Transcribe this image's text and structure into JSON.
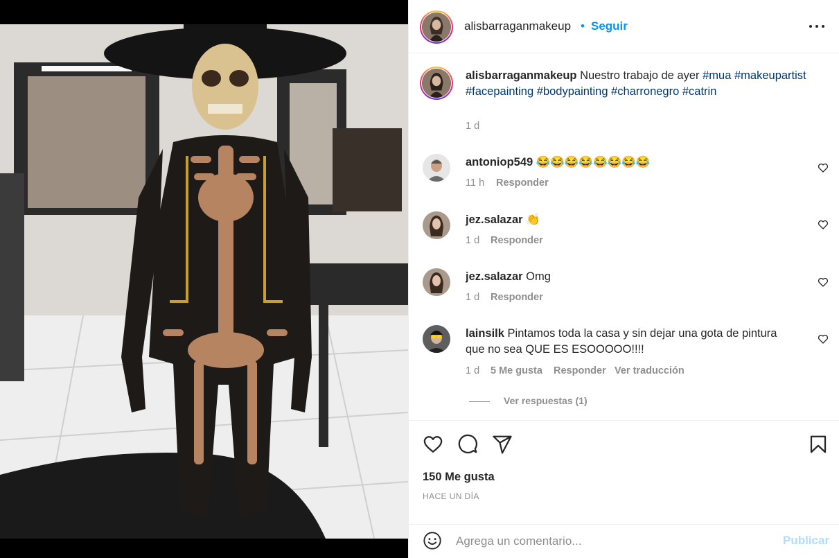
{
  "post": {
    "author": "alisbarraganmakeup",
    "follow_dot": "•",
    "follow_label": "Seguir",
    "more_icon": "more-horizontal-icon"
  },
  "caption": {
    "username": "alisbarraganmakeup",
    "text": "Nuestro trabajo de ayer",
    "hashtags": [
      "#mua",
      "#makeupartist",
      "#facepainting",
      "#bodypainting",
      "#charronegro",
      "#catrin"
    ],
    "time": "1 d"
  },
  "comments": [
    {
      "username": "antoniop549",
      "text": "😂😂😂😂😂😂😂😂",
      "time": "11 h",
      "likes": "",
      "reply_label": "Responder",
      "translate_label": ""
    },
    {
      "username": "jez.salazar",
      "text": "👏",
      "time": "1 d",
      "likes": "",
      "reply_label": "Responder",
      "translate_label": ""
    },
    {
      "username": "jez.salazar",
      "text": "Omg",
      "time": "1 d",
      "likes": "",
      "reply_label": "Responder",
      "translate_label": ""
    },
    {
      "username": "lainsilk",
      "text": "Pintamos toda la casa y sin dejar una gota de pintura que no sea QUE ES ESOOOOO!!!!",
      "time": "1 d",
      "likes": "5 Me gusta",
      "reply_label": "Responder",
      "translate_label": "Ver traducción"
    }
  ],
  "view_replies": "Ver respuestas (1)",
  "actions": {
    "like_icon": "heart-icon",
    "comment_icon": "comment-icon",
    "share_icon": "send-icon",
    "save_icon": "bookmark-icon"
  },
  "likes_count": "150 Me gusta",
  "posted_time": "HACE UN DÍA",
  "add_comment": {
    "placeholder": "Agrega un comentario...",
    "publish_label": "Publicar",
    "emoji_icon": "emoji-icon"
  },
  "colors": {
    "accent": "#0095f6",
    "hashtag": "#00376b",
    "muted": "#8e8e8e",
    "publish_disabled": "#b3dbff"
  }
}
